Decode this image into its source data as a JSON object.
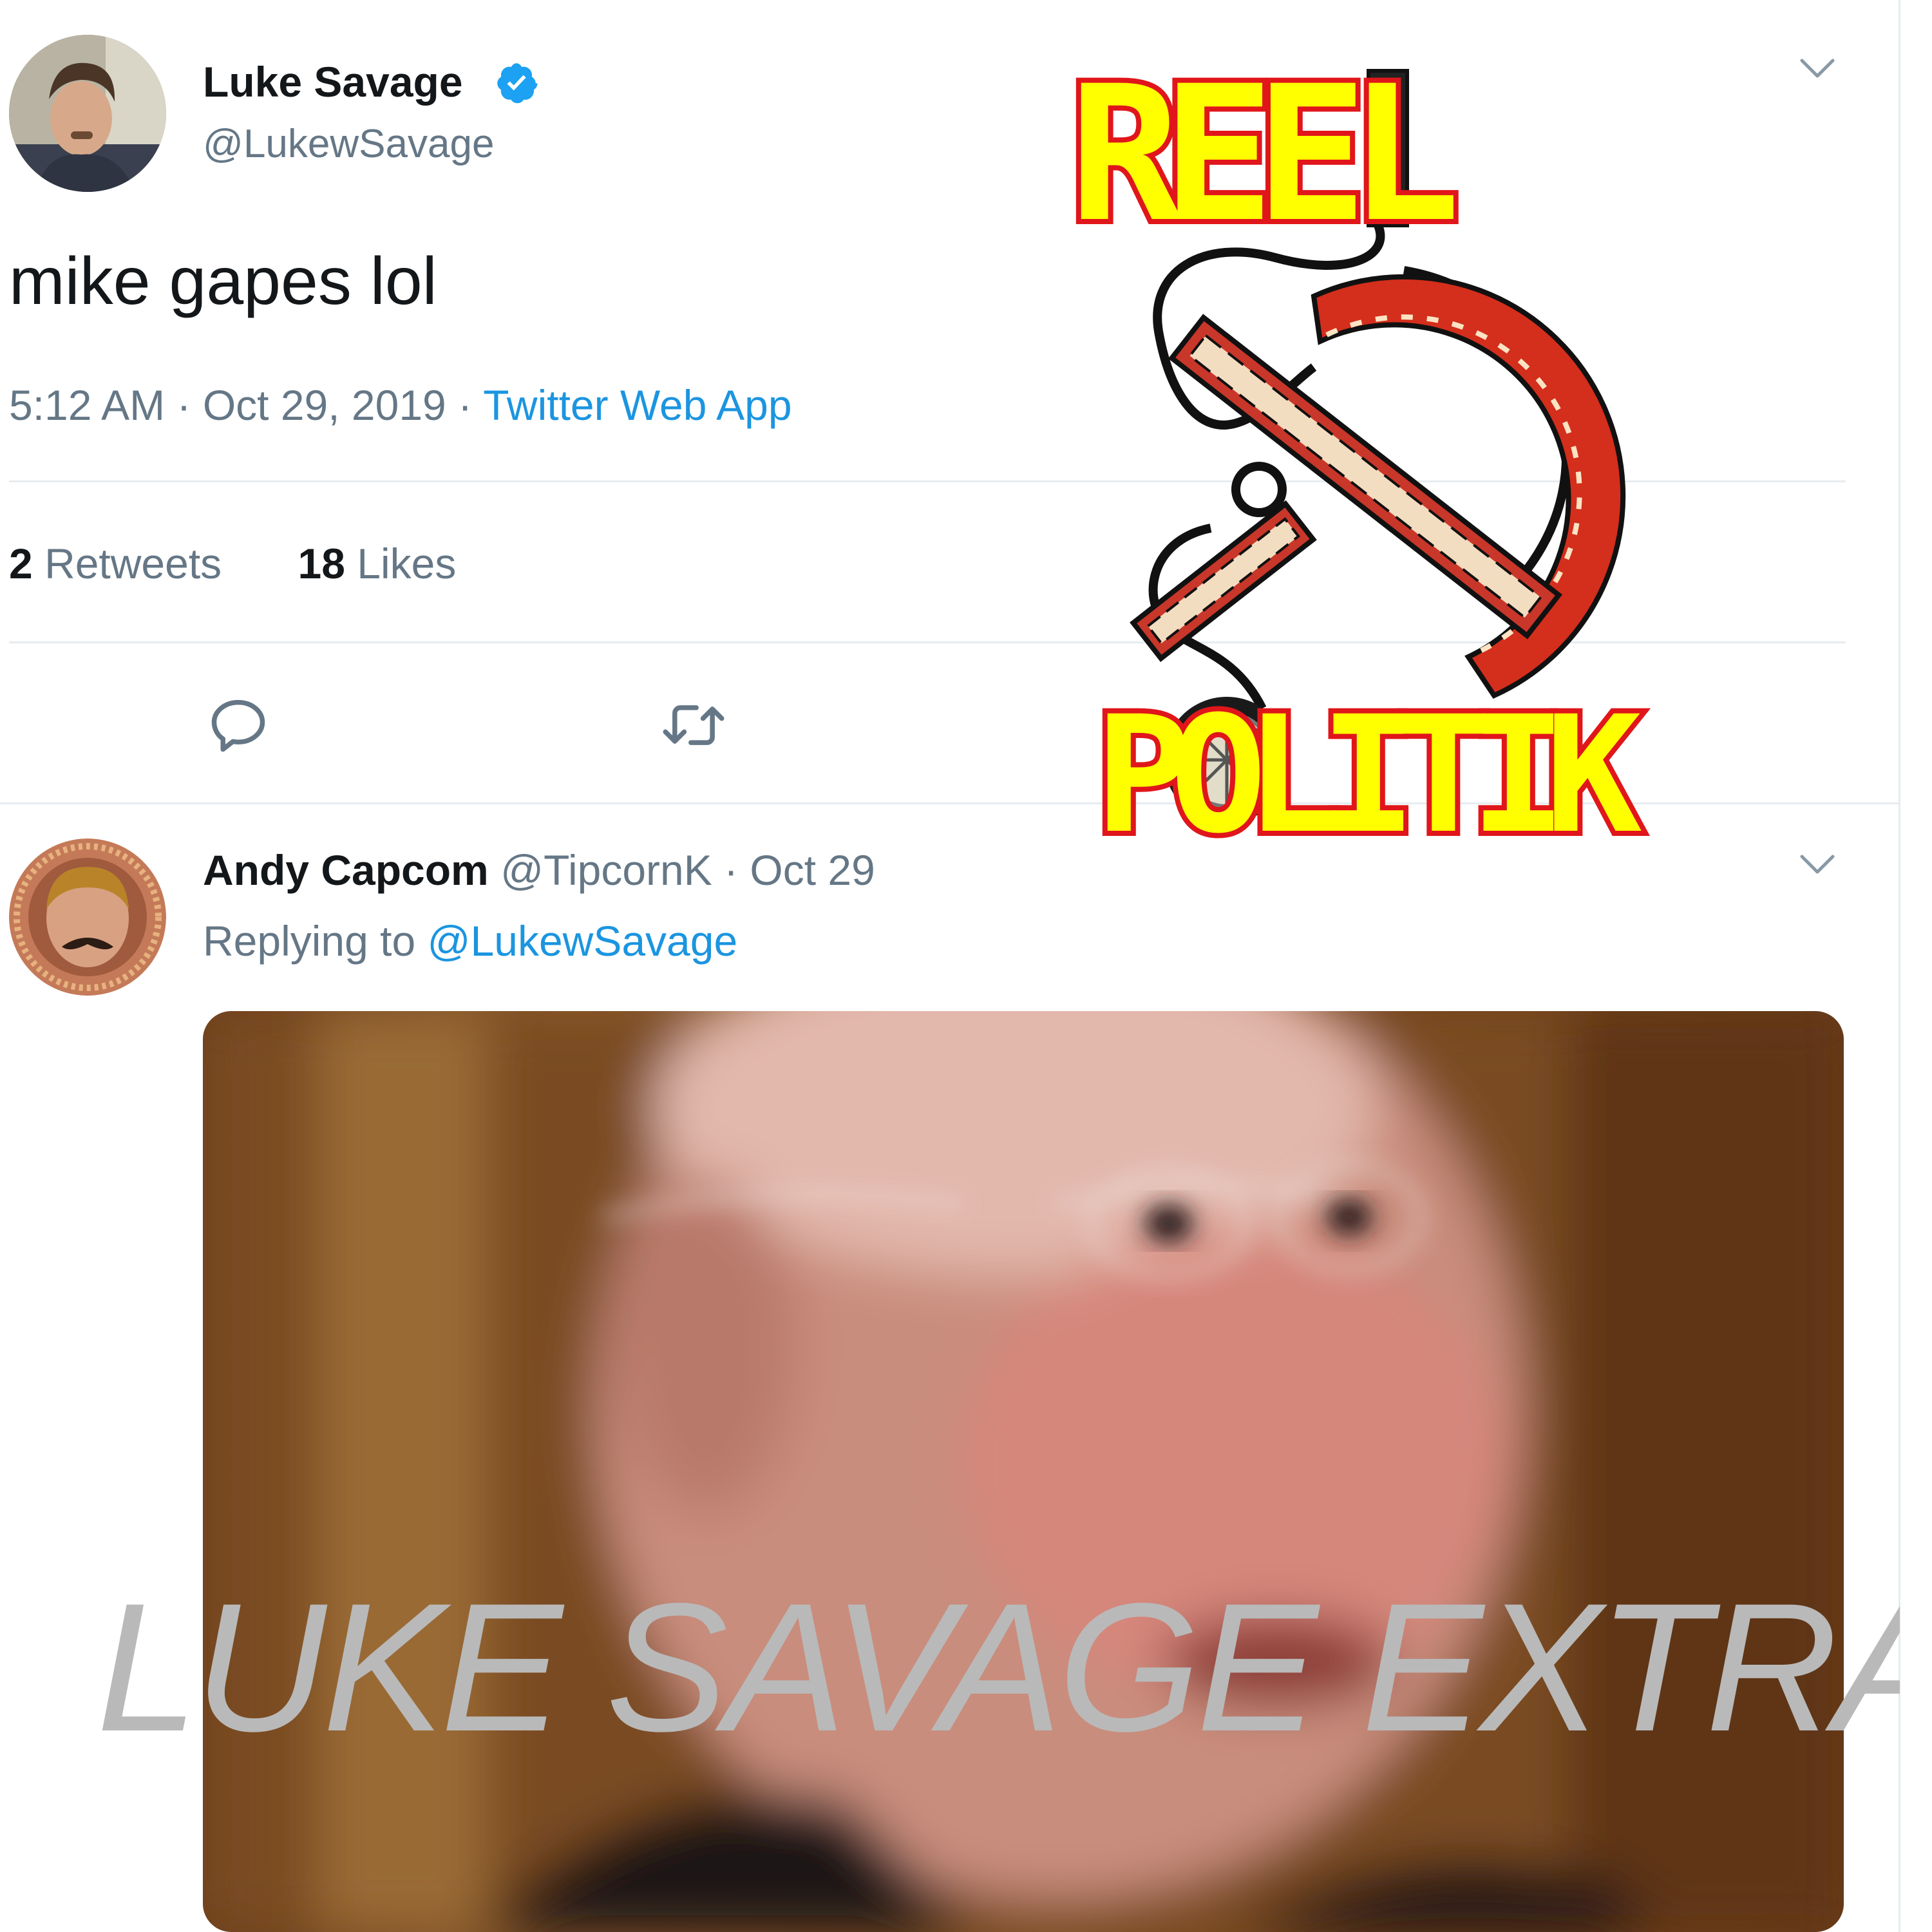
{
  "tweet": {
    "author_name": "Luke Savage",
    "author_handle": "@LukewSavage",
    "verified": true,
    "text": "mike gapes lol",
    "time": "5:12 AM",
    "dot": "·",
    "date": "Oct 29, 2019",
    "source": "Twitter Web App",
    "retweets_count": "2",
    "retweets_label": "Retweets",
    "likes_count": "18",
    "likes_label": "Likes"
  },
  "reply": {
    "author_name": "Andy Capcom",
    "author_handle": "@TipcornK",
    "dot": "·",
    "date": "Oct 29",
    "replying_prefix": "Replying to",
    "replying_handle": "@LukewSavage"
  },
  "logo": {
    "top_word": "REEL",
    "bottom_word": "POLITIK",
    "colors": {
      "fill": "#ffff00",
      "outline": "#e0161b",
      "sickle": "#d42e1c"
    }
  },
  "watermark": {
    "text": "LUKE SAVAGE EXTRA"
  },
  "icons": [
    "verified-badge-icon",
    "chevron-down-icon",
    "reply-icon",
    "retweet-icon"
  ],
  "colors": {
    "link": "#1b95e0",
    "muted": "#657786",
    "divider": "#e6ecf0"
  }
}
